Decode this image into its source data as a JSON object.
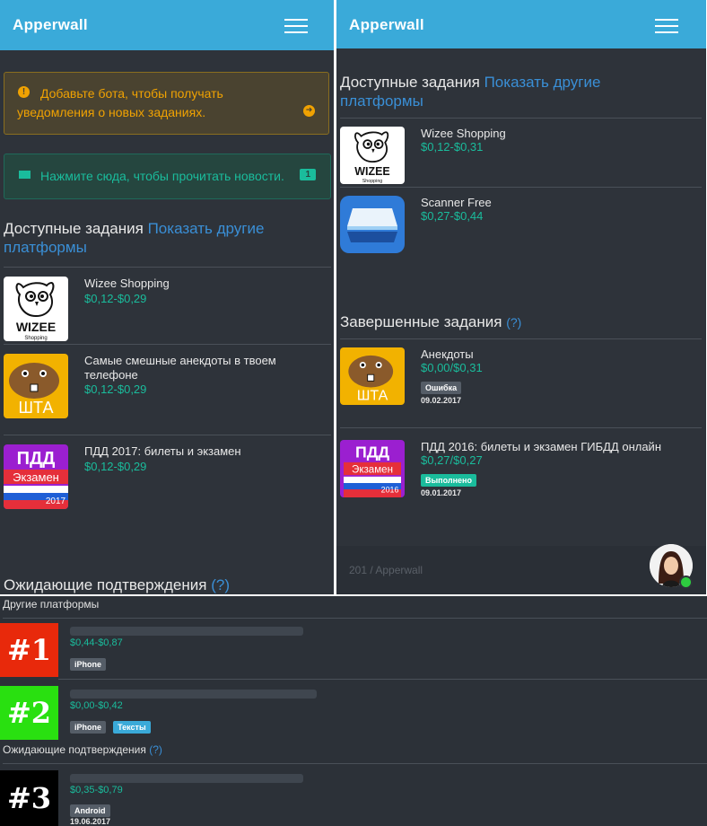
{
  "app": {
    "brand": "Apperwall"
  },
  "left": {
    "alert_warning": "Добавьте бота, чтобы получать уведомления о новых заданиях.",
    "alert_news": "Нажмите сюда, чтобы прочитать новости.",
    "news_count": "1",
    "section_available": "Доступные задания",
    "show_other": "Показать другие платформы",
    "section_pending": "Ожидающие подтверждения",
    "help_mark": "(?)",
    "apps": [
      {
        "name": "Wizee Shopping",
        "price": "$0,12-$0,29",
        "icon": "wizee-owl-logo"
      },
      {
        "name": "Самые смешные анекдоты в твоем телефоне",
        "price": "$0,12-$0,29",
        "icon": "beaver-shta-logo"
      },
      {
        "name": "ПДД 2017: билеты и экзамен",
        "price": "$0,12-$0,29",
        "icon": "pdd-2017-logo"
      }
    ]
  },
  "right": {
    "section_available": "Доступные задания",
    "show_other": "Показать другие платформы",
    "section_done": "Завершенные задания",
    "help_mark": "(?)",
    "apps": [
      {
        "name": "Wizee Shopping",
        "price": "$0,12-$0,31",
        "icon": "wizee-owl-logo"
      },
      {
        "name": "Scanner Free",
        "price": "$0,27-$0,44",
        "icon": "scanner-logo"
      }
    ],
    "completed": [
      {
        "name": "Анекдоты",
        "price": "$0,00/$0,31",
        "status": "Ошибка",
        "date": "09.02.2017",
        "icon": "beaver-shta-logo"
      },
      {
        "name": "ПДД 2016: билеты и экзамен ГИБДД онлайн",
        "price": "$0,27/$0,27",
        "status": "Выполнено",
        "date": "09.01.2017",
        "icon": "pdd-2016-logo"
      }
    ],
    "footer": "201 / Apperwall"
  },
  "bottom": {
    "section_other": "Другие платформы",
    "section_pending": "Ожидающие подтверждения",
    "help_mark": "(?)",
    "items": [
      {
        "num": "#1",
        "price": "$0,44-$0,87",
        "tags": [
          "iPhone"
        ],
        "color": "#e8290b"
      },
      {
        "num": "#2",
        "price": "$0,00-$0,42",
        "tags": [
          "iPhone",
          "Тексты"
        ],
        "color": "#29e010"
      },
      {
        "num": "#3",
        "price": "$0,35-$0,79",
        "tags": [
          "Android"
        ],
        "date": "19.06.2017",
        "color": "#000000"
      }
    ]
  },
  "colors": {
    "accent": "#3aaad9",
    "price": "#1abc9c",
    "link": "#3a8fd6",
    "bg": "#2e333a"
  }
}
